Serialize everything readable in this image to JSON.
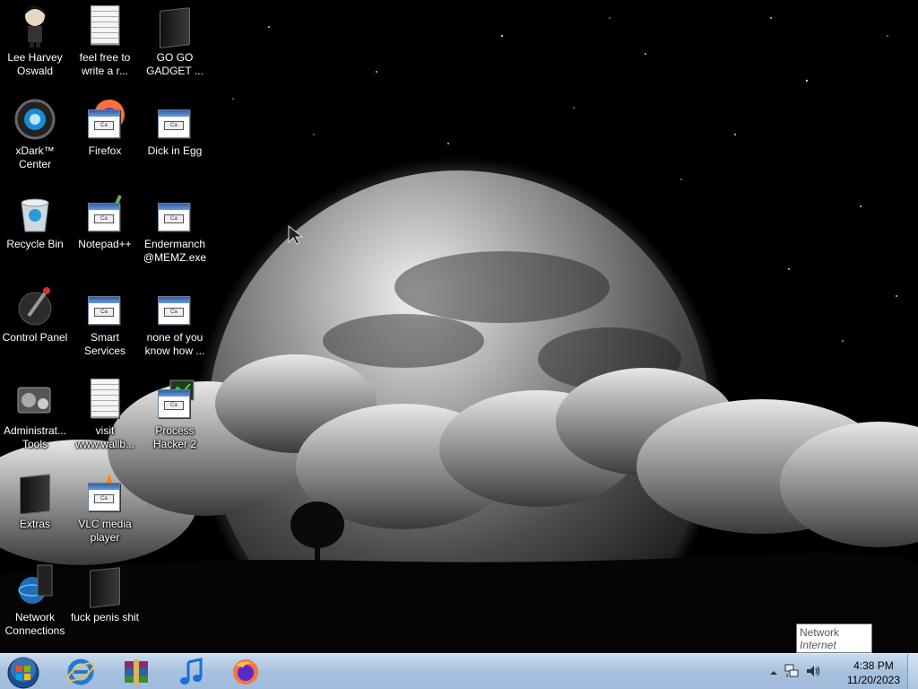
{
  "desktop": {
    "icons": [
      {
        "label": "Lee Harvey Oswald",
        "icon": "character-figure-icon"
      },
      {
        "label": "feel free to write a r...",
        "icon": "text-document-icon"
      },
      {
        "label": "GO GO GADGET ...",
        "icon": "dark-folder-icon"
      },
      {
        "label": "xDark™ Center",
        "icon": "xdark-center-icon"
      },
      {
        "label": "Firefox",
        "icon": "firefox-shortcut-icon"
      },
      {
        "label": "Dick in Egg",
        "icon": "program-shortcut-icon"
      },
      {
        "label": "Recycle Bin",
        "icon": "recycle-bin-icon"
      },
      {
        "label": "Notepad++",
        "icon": "notepad-plus-plus-icon"
      },
      {
        "label": "Endermanch @MEMZ.exe",
        "icon": "program-shortcut-icon"
      },
      {
        "label": "Control Panel",
        "icon": "control-panel-icon"
      },
      {
        "label": "Smart Services",
        "icon": "program-shortcut-icon"
      },
      {
        "label": "none of you know how ...",
        "icon": "program-shortcut-icon"
      },
      {
        "label": "Administrat... Tools",
        "icon": "administrative-tools-icon"
      },
      {
        "label": "visit www.wallb...",
        "icon": "text-document-icon"
      },
      {
        "label": "Process Hacker 2",
        "icon": "process-hacker-icon"
      },
      {
        "label": "Extras",
        "icon": "dark-folder-icon"
      },
      {
        "label": "VLC media player",
        "icon": "vlc-cone-icon"
      },
      {
        "label": "Network Connections",
        "icon": "network-connections-icon"
      },
      {
        "label": "fuck penis shit",
        "icon": "dark-folder-icon"
      }
    ]
  },
  "taskbar": {
    "pinned": [
      {
        "name": "Internet Explorer",
        "icon": "internet-explorer-icon"
      },
      {
        "name": "WinRAR",
        "icon": "winrar-icon"
      },
      {
        "name": "iTunes",
        "icon": "music-note-icon"
      },
      {
        "name": "Firefox",
        "icon": "firefox-icon"
      }
    ],
    "clock": {
      "time": "4:38 PM",
      "date": "11/20/2023"
    }
  },
  "tooltip": {
    "title": "Network",
    "subtitle": "Internet access"
  },
  "colors": {
    "taskbar": "#a7c1de",
    "sky": "#000000",
    "label_text": "#ffffff"
  }
}
